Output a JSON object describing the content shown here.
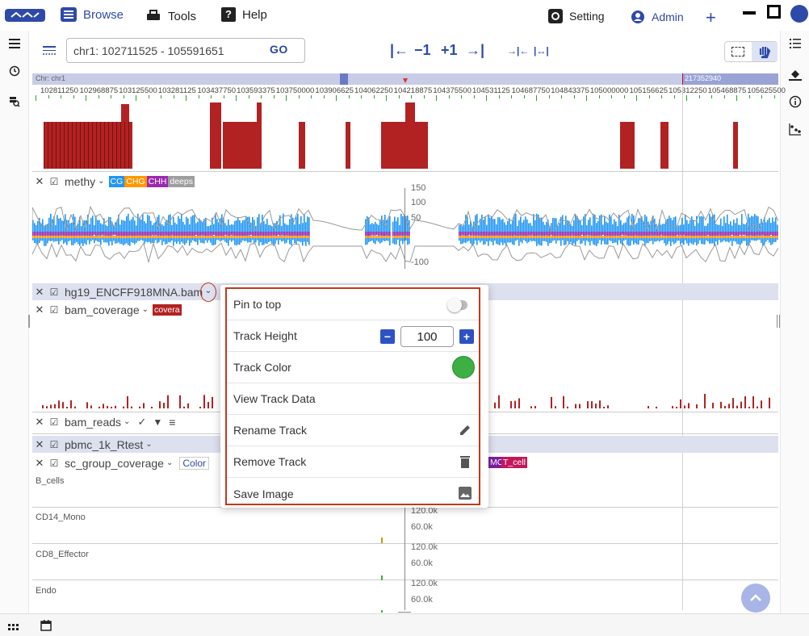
{
  "nav": {
    "browse": "Browse",
    "tools": "Tools",
    "help": "Help",
    "setting": "Setting",
    "admin": "Admin",
    "add": "+"
  },
  "locus": {
    "value": "chr1: 102711525 - 105591651",
    "go": "GO",
    "btn_start": "|←",
    "btn_minus": "−1",
    "btn_plus": "+1",
    "btn_end": "→|",
    "btn_zoom_in": "→|←",
    "btn_zoom_out": "|↔|"
  },
  "ruler": {
    "chr_label": "Chr: chr1",
    "chr_end": "217352940",
    "ticks": [
      "102811250",
      "102968875",
      "103125500",
      "103281125",
      "103437750",
      "103593375",
      "103750000",
      "103906625",
      "104062250",
      "104218875",
      "104375500",
      "104531125",
      "104687750",
      "104843375",
      "105000000",
      "105156625",
      "105312250",
      "105468875",
      "105625500"
    ]
  },
  "tracks": {
    "methy": {
      "name": "methy",
      "chips": [
        "CG",
        "CHG",
        "CHH",
        "deeps"
      ],
      "chip_colors": [
        "#2196f3",
        "#ff9800",
        "#9c27b0",
        "#9e9e9e"
      ],
      "axis": [
        "150",
        "100",
        "50",
        "-100"
      ]
    },
    "bam": {
      "name": "hg19_ENCFF918MNA.bam"
    },
    "bam_coverage": {
      "name": "bam_coverage",
      "chip": "covera"
    },
    "bam_reads": {
      "name": "bam_reads"
    },
    "pbmc": {
      "name": "pbmc_1k_Rtest"
    },
    "sc_group": {
      "name": "sc_group_coverage",
      "chip_color": "Color",
      "chip_mc": "MC",
      "chip_tcell": "T_cell"
    },
    "sc_labels": [
      "B_cells",
      "CD14_Mono",
      "CD8_Effector",
      "Endo"
    ],
    "sc_axis": [
      "120.0k",
      "60.0k"
    ]
  },
  "popup": {
    "pin": "Pin to top",
    "height_label": "Track Height",
    "height_value": "100",
    "color_label": "Track Color",
    "view_data": "View Track Data",
    "rename": "Rename Track",
    "remove": "Remove Track",
    "save": "Save Image",
    "track_color": "#3cb043"
  },
  "colors": {
    "brand": "#2e4aa8",
    "bar_red": "#b22222",
    "popup_border": "#c0391b"
  }
}
